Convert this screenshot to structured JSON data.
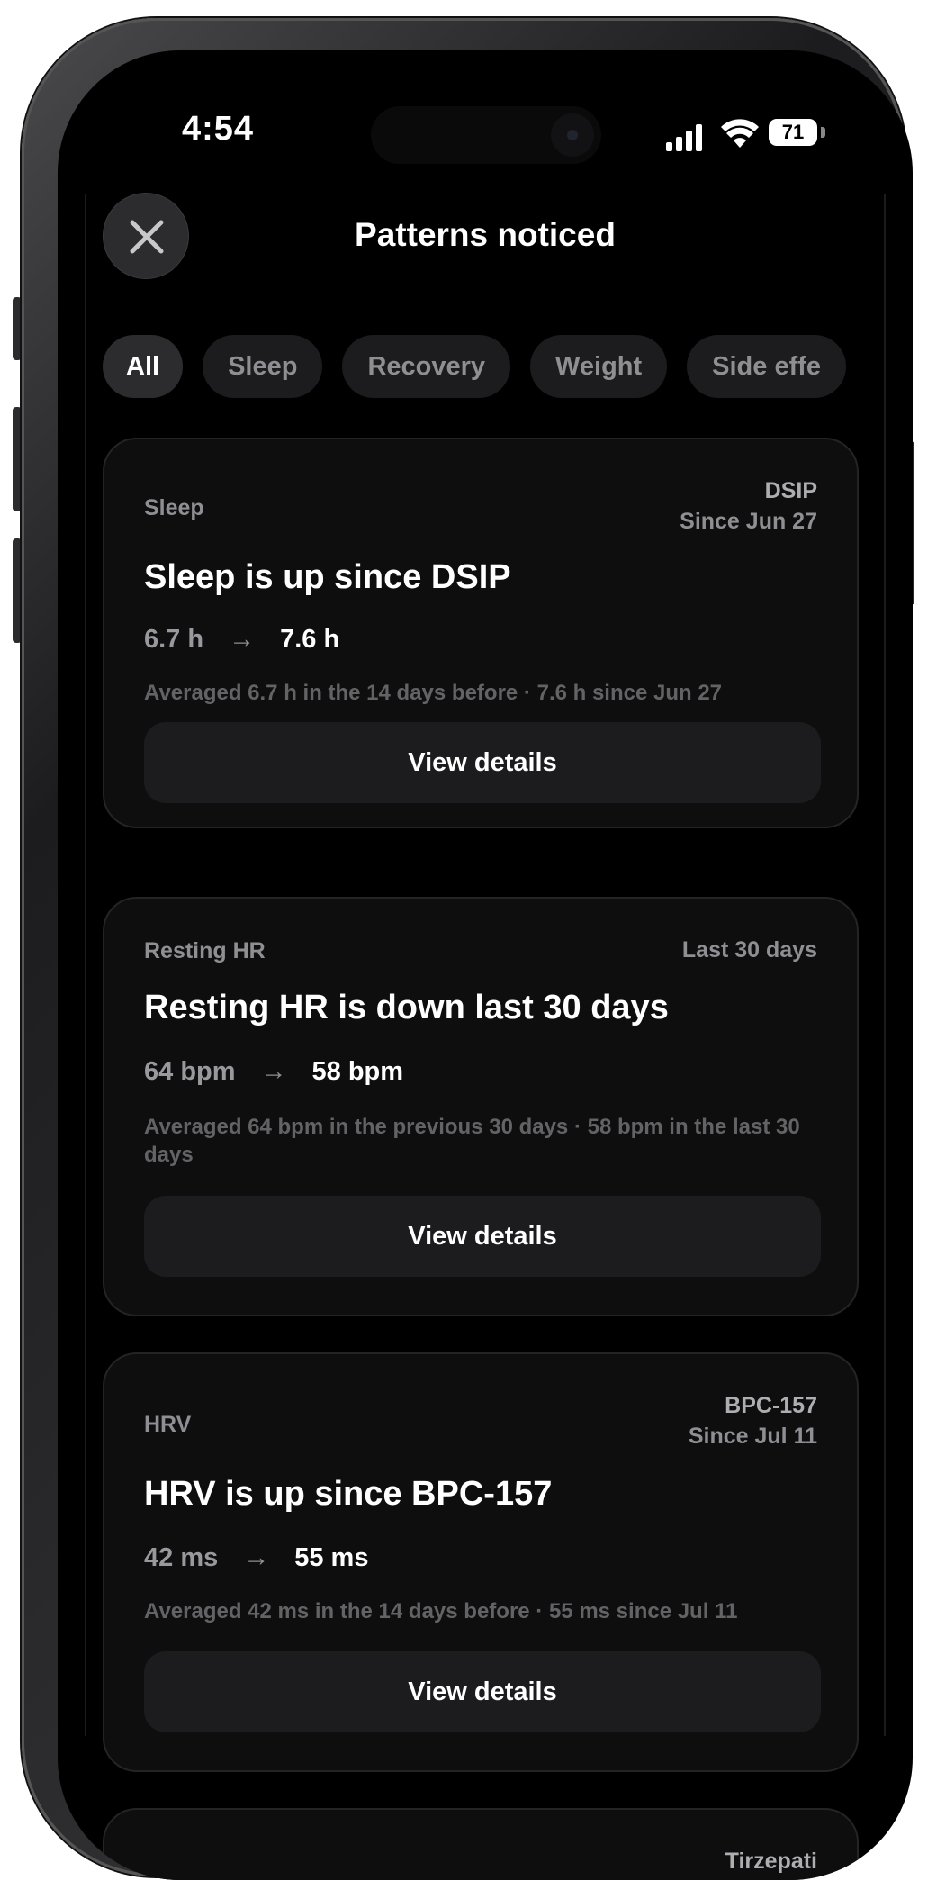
{
  "status_bar": {
    "time": "4:54",
    "battery": "71",
    "signal_icon": "cellular-signal-icon",
    "wifi_icon": "wifi-icon"
  },
  "header": {
    "title": "Patterns noticed",
    "close_icon": "close-icon"
  },
  "filters": [
    {
      "label": "All",
      "selected": true
    },
    {
      "label": "Sleep",
      "selected": false
    },
    {
      "label": "Recovery",
      "selected": false
    },
    {
      "label": "Weight",
      "selected": false
    },
    {
      "label": "Side effe",
      "selected": false
    }
  ],
  "cards": [
    {
      "category": "Sleep",
      "meta_primary": "DSIP",
      "meta_secondary": "Since Jun 27",
      "title": "Sleep is up since DSIP",
      "before": "6.7 h",
      "arrow": "→",
      "after": "7.6 h",
      "description": "Averaged 6.7 h in the 14 days before · 7.6 h since Jun 27",
      "button": "View details"
    },
    {
      "category": "Resting HR",
      "meta_primary": "Last 30 days",
      "title": "Resting HR is down last 30 days",
      "before": "64 bpm",
      "arrow": "→",
      "after": "58 bpm",
      "description": "Averaged 64 bpm in the previous 30 days · 58 bpm in the last 30 days",
      "button": "View details"
    },
    {
      "category": "HRV",
      "meta_primary": "BPC-157",
      "meta_secondary": "Since Jul 11",
      "title": "HRV is up since BPC-157",
      "before": "42 ms",
      "arrow": "→",
      "after": "55 ms",
      "description": "Averaged 42 ms in the 14 days before · 55 ms since Jul 11",
      "button": "View details"
    },
    {
      "meta_primary": "Tirzepati"
    }
  ]
}
